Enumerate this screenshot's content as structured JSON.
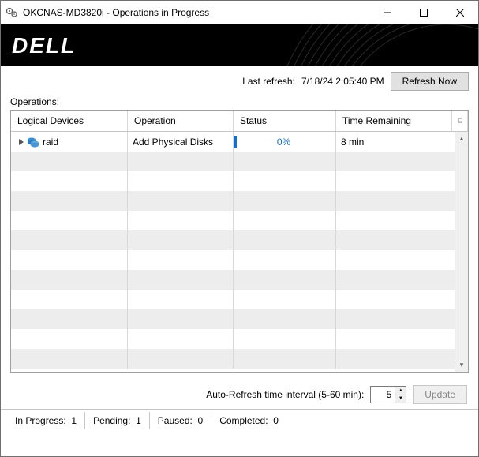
{
  "window": {
    "title": "OKCNAS-MD3820i - Operations in Progress"
  },
  "banner": {
    "brand": "DELL"
  },
  "refresh": {
    "last_label": "Last refresh:",
    "last_time": "7/18/24 2:05:40 PM",
    "button": "Refresh Now"
  },
  "operations": {
    "label": "Operations:",
    "columns": {
      "logical_devices": "Logical Devices",
      "operation": "Operation",
      "status": "Status",
      "time_remaining": "Time Remaining"
    },
    "rows": [
      {
        "device": "raid",
        "operation": "Add Physical Disks",
        "status": "0%",
        "time_remaining": "8 min"
      }
    ]
  },
  "auto_refresh": {
    "label": "Auto-Refresh time interval (5-60 min):",
    "value": "5",
    "update_button": "Update"
  },
  "status": {
    "in_progress_label": "In Progress:",
    "in_progress": "1",
    "pending_label": "Pending:",
    "pending": "1",
    "paused_label": "Paused:",
    "paused": "0",
    "completed_label": "Completed:",
    "completed": "0"
  }
}
